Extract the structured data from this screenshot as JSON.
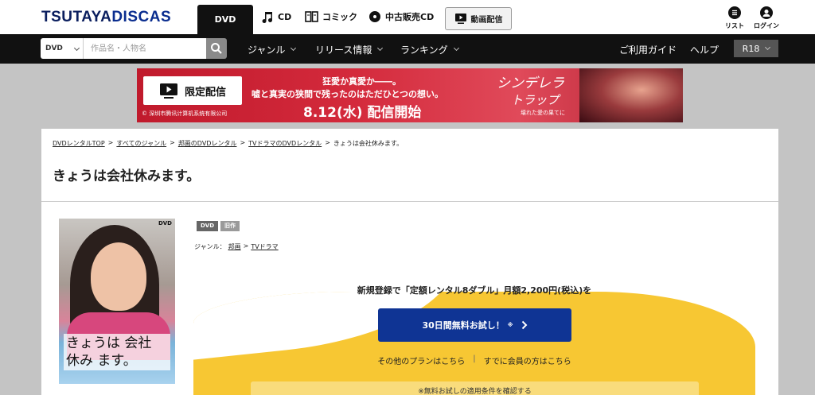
{
  "header": {
    "logo": "TSUTAYA DISCAS",
    "logo_part1": "TSUTAYA",
    "logo_part2": "DISCAS",
    "tabs": [
      {
        "label": "DVD",
        "icon": "none",
        "active": true
      },
      {
        "label": "CD",
        "icon": "music-note-icon"
      },
      {
        "label": "コミック",
        "icon": "book-icon"
      },
      {
        "label": "中古販売CD",
        "icon": "used-cd-icon"
      }
    ],
    "stream_button": "動画配信",
    "user_icons": [
      {
        "label": "リスト",
        "icon": "list-icon"
      },
      {
        "label": "ログイン",
        "icon": "user-icon"
      }
    ]
  },
  "nav": {
    "search_category": "DVD",
    "search_placeholder": "作品名・人物名",
    "items": [
      {
        "label": "ジャンル"
      },
      {
        "label": "リリース情報"
      },
      {
        "label": "ランキング"
      }
    ],
    "guide": "ご利用ガイド",
    "help": "ヘルプ",
    "r18": "R18"
  },
  "banner": {
    "badge": "限定配信",
    "copyright": "© 深圳市腾讯计算机系统有限公司",
    "line1": "狂愛か真愛か――。",
    "line2": "嘘と真実の狭間で残ったのはただひとつの想い。",
    "line3": "8.12(水) 配信開始",
    "title_a": "シンデレラ",
    "title_b": "トラップ",
    "subtitle": "壊れた愛の果てに"
  },
  "breadcrumbs": [
    "DVDレンタルTOP",
    "すべてのジャンル",
    "邦画のDVDレンタル",
    "TVドラマのDVDレンタル",
    "きょうは会社休みます。"
  ],
  "breadcrumb_sep": ">",
  "page": {
    "title": "きょうは会社休みます。",
    "cover_title": "きょうは 会社 休み ます。",
    "cover_mark": "DVD",
    "badges": [
      "DVD",
      "旧作"
    ],
    "genre_label": "ジャンル：",
    "genres": [
      "邦画",
      "TVドラマ"
    ],
    "genre_sep": ">"
  },
  "promo": {
    "headline": "新規登録で「定額レンタル8ダブル」月額2,200円(税込)を",
    "cta": "30日間無料お試し！",
    "cta_mark": "※",
    "link1": "その他のプランはこちら",
    "link2": "すでに会員の方はこちら",
    "link_sep": "|",
    "note": "※無料お試しの適用条件を確認する"
  },
  "colors": {
    "brand_navy": "#0a1e5e",
    "cta_blue": "#0f3494",
    "promo_yellow": "#f7c733",
    "banner_red": "#c01a2c"
  }
}
